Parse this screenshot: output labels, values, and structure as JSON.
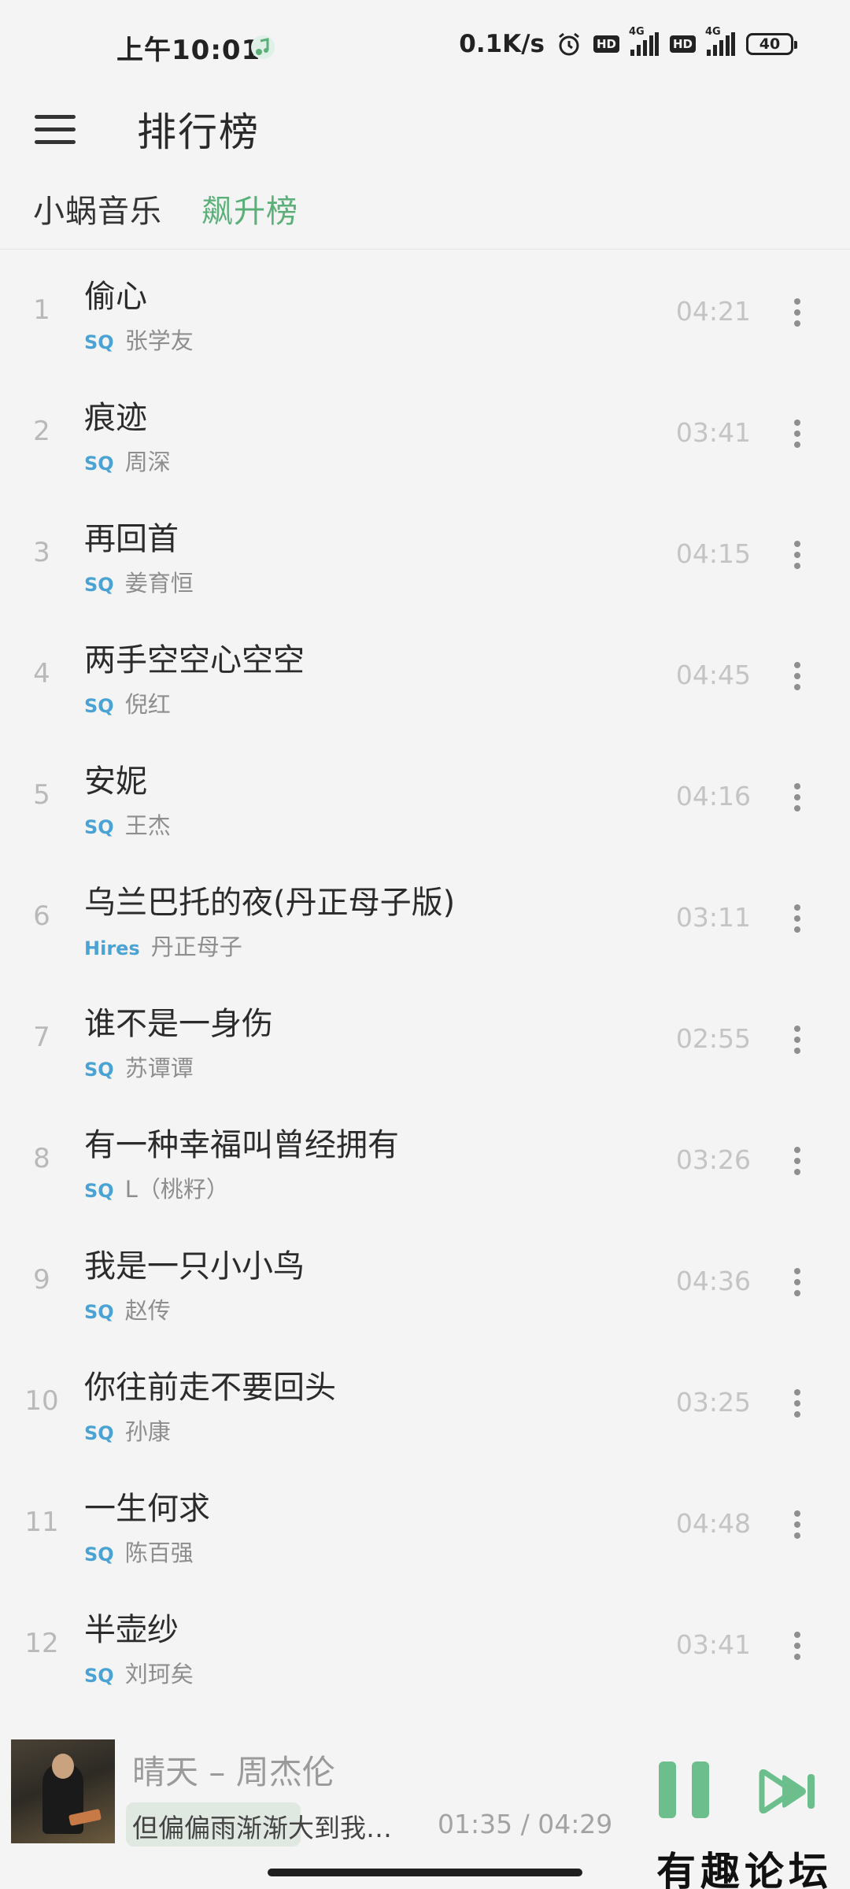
{
  "status_bar": {
    "time": "上午10:01",
    "network_speed": "0.1K/s",
    "hd_label": "HD",
    "net_type": "4G",
    "battery": "40"
  },
  "header": {
    "title": "排行榜"
  },
  "tabs": [
    {
      "label": "小蜗音乐"
    },
    {
      "label": "飙升榜"
    }
  ],
  "accent_color": "#5bb07a",
  "quality_color": "#4aa3d4",
  "songs": [
    {
      "rank": "1",
      "title": "偷心",
      "quality": "SQ",
      "artist": "张学友",
      "duration": "04:21"
    },
    {
      "rank": "2",
      "title": "痕迹",
      "quality": "SQ",
      "artist": "周深",
      "duration": "03:41"
    },
    {
      "rank": "3",
      "title": "再回首",
      "quality": "SQ",
      "artist": "姜育恒",
      "duration": "04:15"
    },
    {
      "rank": "4",
      "title": "两手空空心空空",
      "quality": "SQ",
      "artist": "倪红",
      "duration": "04:45"
    },
    {
      "rank": "5",
      "title": "安妮",
      "quality": "SQ",
      "artist": "王杰",
      "duration": "04:16"
    },
    {
      "rank": "6",
      "title": "乌兰巴托的夜(丹正母子版)",
      "quality": "Hires",
      "artist": "丹正母子",
      "duration": "03:11"
    },
    {
      "rank": "7",
      "title": "谁不是一身伤",
      "quality": "SQ",
      "artist": "苏谭谭",
      "duration": "02:55"
    },
    {
      "rank": "8",
      "title": "有一种幸福叫曾经拥有",
      "quality": "SQ",
      "artist": "L（桃籽）",
      "duration": "03:26"
    },
    {
      "rank": "9",
      "title": "我是一只小小鸟",
      "quality": "SQ",
      "artist": "赵传",
      "duration": "04:36"
    },
    {
      "rank": "10",
      "title": "你往前走不要回头",
      "quality": "SQ",
      "artist": "孙康",
      "duration": "03:25"
    },
    {
      "rank": "11",
      "title": "一生何求",
      "quality": "SQ",
      "artist": "陈百强",
      "duration": "04:48"
    },
    {
      "rank": "12",
      "title": "半壶纱",
      "quality": "SQ",
      "artist": "刘珂矣",
      "duration": "03:41"
    }
  ],
  "player": {
    "now_playing": "晴天 – 周杰伦",
    "lyric": "但偏偏雨渐渐大到我…",
    "progress": "01:35 / 04:29"
  },
  "watermark": "有趣论坛",
  "icons": {
    "menu": "menu-icon",
    "more": "more-vertical-icon",
    "pause": "pause-icon",
    "next": "skip-next-icon",
    "music_note": "music-note-icon",
    "alarm": "alarm-icon",
    "signal": "signal-icon",
    "battery": "battery-icon"
  }
}
